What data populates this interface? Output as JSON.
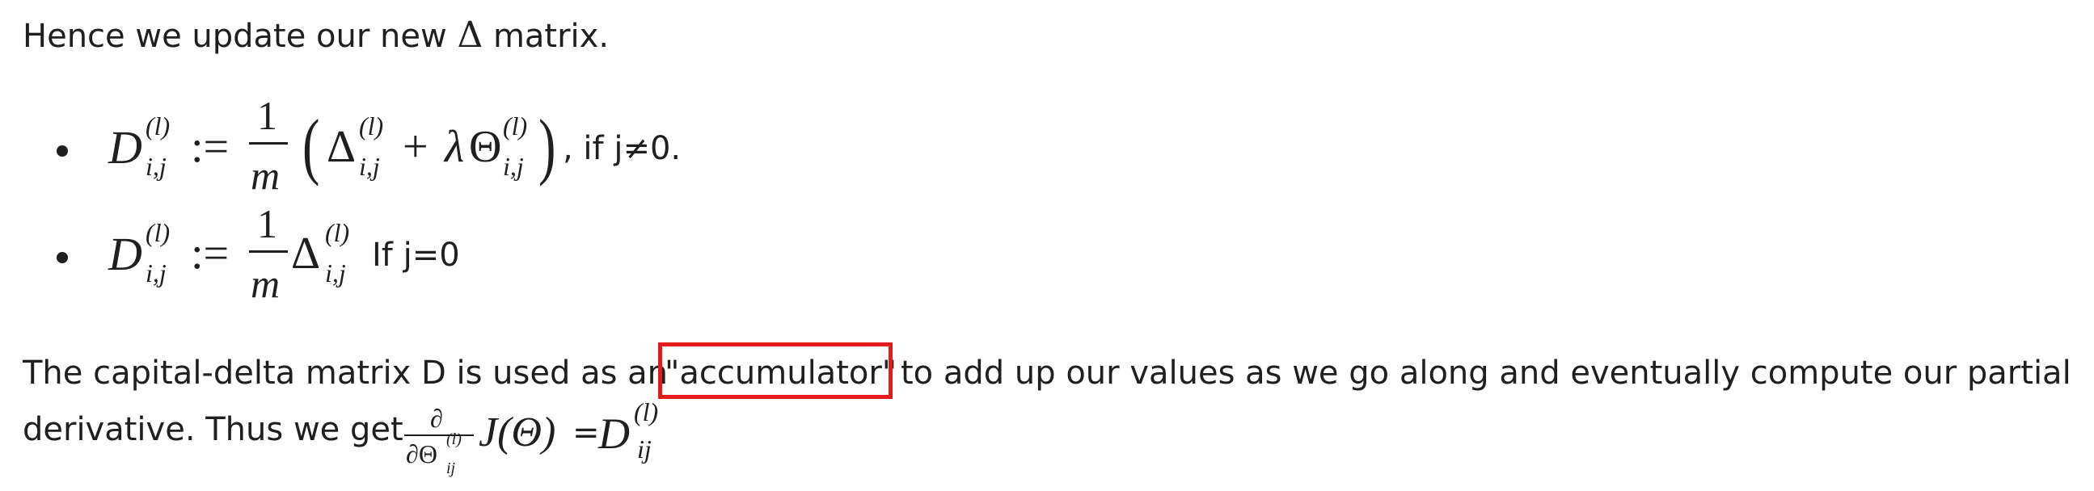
{
  "intro": {
    "text_before": "Hence we update our new",
    "delta_symbol": "Δ",
    "text_after": "matrix."
  },
  "bullets": [
    {
      "formula_symbols": {
        "D": "D",
        "superscript": "(l)",
        "subscript": "i,j",
        "assign": ":=",
        "numerator": "1",
        "denominator": "m",
        "open_paren": "(",
        "delta": "Δ",
        "plus": "+",
        "lambda": "λ",
        "theta": "Θ",
        "close_paren": ")"
      },
      "condition": ", if j≠0."
    },
    {
      "formula_symbols": {
        "D": "D",
        "superscript": "(l)",
        "subscript": "i,j",
        "assign": ":=",
        "numerator": "1",
        "denominator": "m",
        "delta": "Δ"
      },
      "condition": "If j=0"
    }
  ],
  "paragraph": {
    "line1_before": "The capital-delta matrix D is used as an",
    "highlighted": "\"accumulator\"",
    "line1_after": "to add up our values as we go along and eventually compute our partial",
    "line2_before": "derivative. Thus we get",
    "partial": "∂",
    "partial_theta": "∂Θ",
    "theta_superscript": "(l)",
    "theta_subscript": "ij",
    "J_expr": "J(Θ)",
    "equals": "=",
    "D": "D",
    "D_superscript": "(l)",
    "D_subscript": "ij"
  },
  "highlight_color": "#e31b1b"
}
